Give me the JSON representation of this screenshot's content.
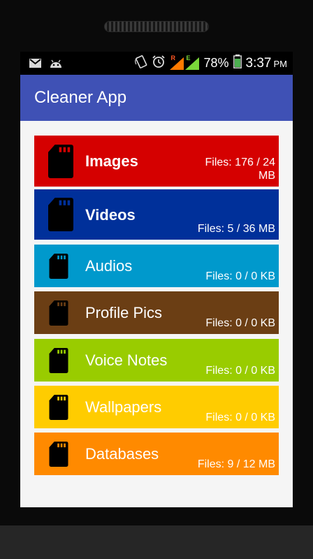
{
  "status_bar": {
    "battery": "78%",
    "time": "3:37",
    "ampm": "PM",
    "net_r": "R",
    "net_e": "E"
  },
  "app_bar": {
    "title": "Cleaner App"
  },
  "categories": [
    {
      "label": "Images",
      "info": "Files: 176 / 24 MB",
      "color": "#d50000",
      "bold": true
    },
    {
      "label": "Videos",
      "info": "Files: 5 / 36 MB",
      "color": "#00309a",
      "bold": true
    },
    {
      "label": "Audios",
      "info": "Files: 0 / 0 KB",
      "color": "#0099cc",
      "bold": false
    },
    {
      "label": "Profile Pics",
      "info": "Files: 0 / 0 KB",
      "color": "#6b3e14",
      "bold": false
    },
    {
      "label": "Voice Notes",
      "info": "Files: 0 / 0 KB",
      "color": "#99cc00",
      "bold": false
    },
    {
      "label": "Wallpapers",
      "info": "Files: 0 / 0 KB",
      "color": "#ffcc00",
      "bold": false
    },
    {
      "label": "Databases",
      "info": "Files: 9 / 12 MB",
      "color": "#ff8a00",
      "bold": false
    }
  ],
  "icons": {
    "sd_card": "sd-card-icon",
    "gmail": "gmail-icon",
    "android": "android-icon",
    "rotate": "rotate-icon",
    "alarm": "alarm-icon",
    "signal": "signal-icon",
    "battery": "battery-icon"
  }
}
